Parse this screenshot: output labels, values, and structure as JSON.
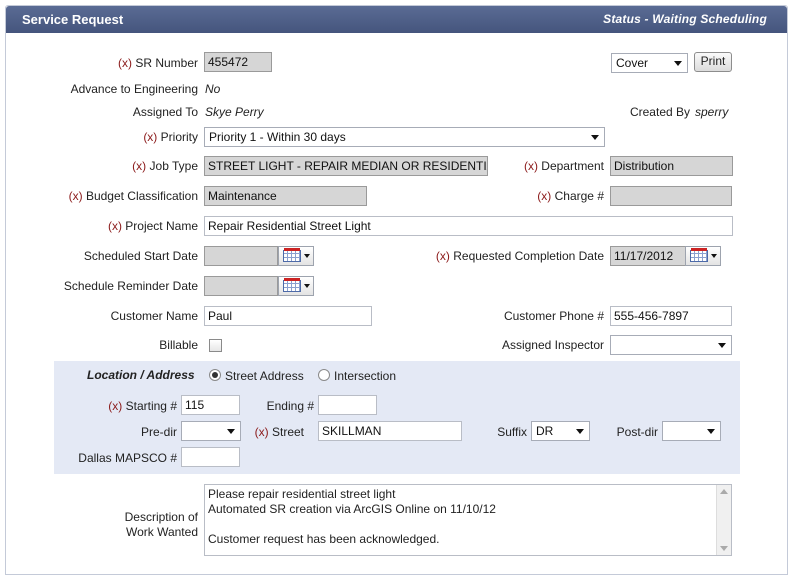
{
  "header": {
    "title": "Service Request",
    "status": "Status - Waiting Scheduling"
  },
  "required_marker": "(x)",
  "sr_number": {
    "label": "SR Number",
    "value": "455472"
  },
  "cover_select": {
    "value": "Cover"
  },
  "print_button": "Print",
  "advance_to_engineering": {
    "label": "Advance to Engineering",
    "value": "No"
  },
  "assigned_to": {
    "label": "Assigned To",
    "value": "Skye Perry"
  },
  "created_by": {
    "label": "Created By",
    "value": "sperry"
  },
  "priority": {
    "label": "Priority",
    "value": "Priority 1 - Within 30 days"
  },
  "job_type": {
    "label": "Job Type",
    "value": "STREET LIGHT - REPAIR MEDIAN OR RESIDENTIAL"
  },
  "department": {
    "label": "Department",
    "value": "Distribution"
  },
  "budget_classification": {
    "label": "Budget Classification",
    "value": "Maintenance"
  },
  "charge": {
    "label": "Charge #",
    "value": ""
  },
  "project_name": {
    "label": "Project Name",
    "value": "Repair Residential Street Light"
  },
  "scheduled_start_date": {
    "label": "Scheduled Start Date",
    "value": ""
  },
  "requested_completion_date": {
    "label": "Requested Completion Date",
    "value": "11/17/2012"
  },
  "schedule_reminder_date": {
    "label": "Schedule Reminder Date",
    "value": ""
  },
  "customer_name": {
    "label": "Customer Name",
    "value": "Paul"
  },
  "customer_phone": {
    "label": "Customer Phone #",
    "value": "555-456-7897"
  },
  "billable": {
    "label": "Billable",
    "checked": false
  },
  "assigned_inspector": {
    "label": "Assigned Inspector",
    "value": ""
  },
  "location": {
    "label": "Location / Address",
    "options": [
      "Street Address",
      "Intersection"
    ],
    "selected": "Street Address",
    "starting_label": "Starting #",
    "starting_value": "115",
    "ending_label": "Ending #",
    "ending_value": "",
    "predir_label": "Pre-dir",
    "predir_value": "",
    "street_label": "Street",
    "street_value": "SKILLMAN",
    "suffix_label": "Suffix",
    "suffix_value": "DR",
    "postdir_label": "Post-dir",
    "postdir_value": "",
    "mapsco_label": "Dallas MAPSCO #",
    "mapsco_value": ""
  },
  "description": {
    "label_line1": "Description of",
    "label_line2": "Work Wanted",
    "lines": [
      "Please repair residential street light",
      "Automated SR creation via ArcGIS Online on 11/10/12",
      "",
      "Customer request has been acknowledged."
    ]
  }
}
